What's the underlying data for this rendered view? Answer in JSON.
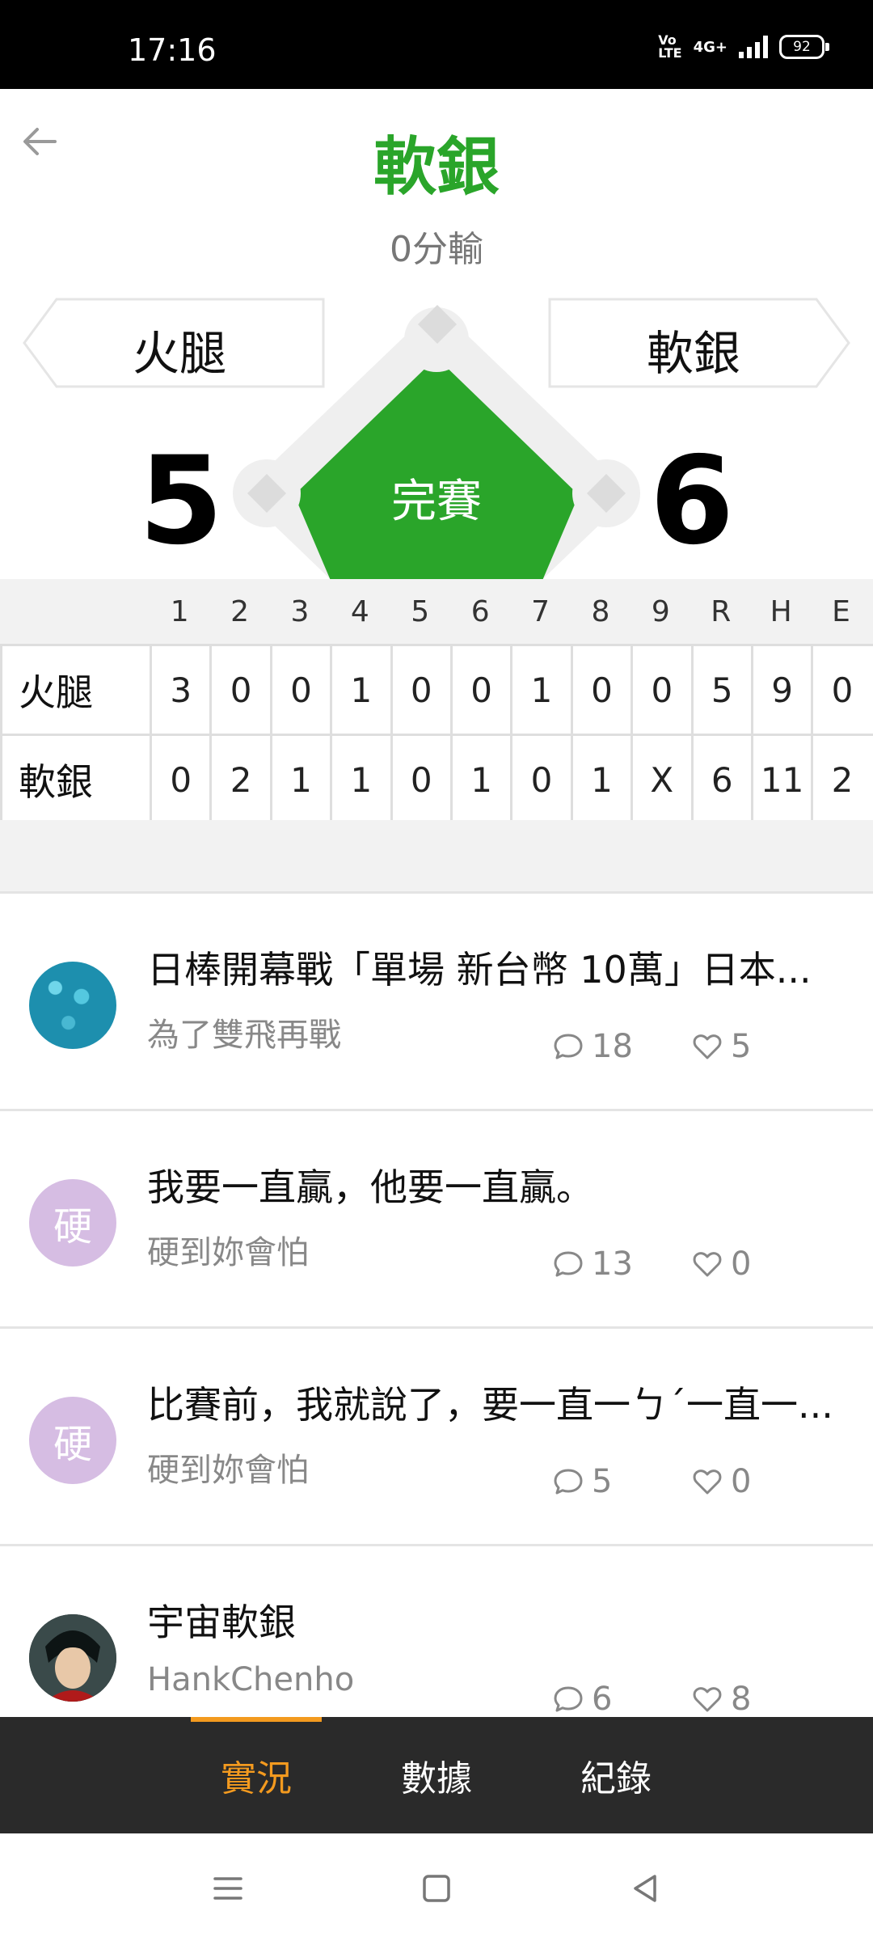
{
  "status_bar": {
    "time": "17:16",
    "volte": "Vo\nLTE",
    "network": "4G+",
    "battery": "92"
  },
  "header": {
    "title": "軟銀",
    "subtitle": "0分輸"
  },
  "game": {
    "away_team": "火腿",
    "home_team": "軟銀",
    "away_score": "5",
    "home_score": "6",
    "status": "完賽"
  },
  "linescore": {
    "headers": [
      "1",
      "2",
      "3",
      "4",
      "5",
      "6",
      "7",
      "8",
      "9",
      "R",
      "H",
      "E"
    ],
    "rows": [
      {
        "team": "火腿",
        "cells": [
          "3",
          "0",
          "0",
          "1",
          "0",
          "0",
          "1",
          "0",
          "0",
          "5",
          "9",
          "0"
        ]
      },
      {
        "team": "軟銀",
        "cells": [
          "0",
          "2",
          "1",
          "1",
          "0",
          "1",
          "0",
          "1",
          "X",
          "6",
          "11",
          "2"
        ]
      }
    ]
  },
  "posts": [
    {
      "title": "日棒開幕戰「單場 新台幣 10萬」日本...",
      "author": "為了雙飛再戰",
      "comments": "18",
      "likes": "5",
      "avatar": "beads-avatar"
    },
    {
      "title": "我要一直贏，他要一直贏。",
      "author": "硬到妳會怕",
      "comments": "13",
      "likes": "0",
      "avatar_letter": "硬"
    },
    {
      "title": "比賽前，我就說了，要一直一ㄅˊ一直一...",
      "author": "硬到妳會怕",
      "comments": "5",
      "likes": "0",
      "avatar_letter": "硬"
    },
    {
      "title": "宇宙軟銀",
      "author": "HankChenho",
      "comments": "6",
      "likes": "8",
      "avatar": "anime-avatar"
    }
  ],
  "tabs": [
    {
      "label": "實況",
      "active": true
    },
    {
      "label": "數據",
      "active": false
    },
    {
      "label": "紀錄",
      "active": false
    }
  ],
  "colors": {
    "accent_green": "#2aa52a",
    "tab_active": "#f39a1f",
    "avatar_purple": "#d6bde3"
  }
}
